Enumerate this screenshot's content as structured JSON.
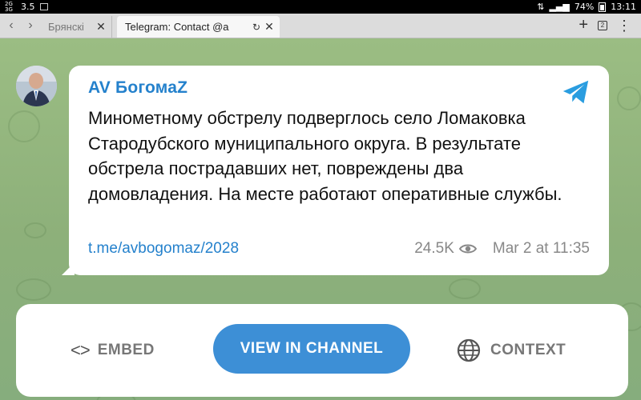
{
  "status_bar": {
    "network_label": "2G/3G",
    "speed": "3.5",
    "battery": "74%",
    "time": "13:11"
  },
  "browser": {
    "tabs": [
      {
        "label": "Брянскі",
        "active": false
      },
      {
        "label": "Telegram: Contact @a",
        "active": true
      }
    ],
    "tab_count": "2"
  },
  "post": {
    "channel_name": "AV БогомаZ",
    "text": "Минометному обстрелу подверглось село Ломаковка Стародубского муниципального округа. В результате обстрела пострадавших нет, повреждены два домовладения. На месте работают оперативные службы.",
    "link": "t.me/avbogomaz/2028",
    "views": "24.5K",
    "date": "Mar 2 at 11:35"
  },
  "actions": {
    "embed_label": "EMBED",
    "view_label": "VIEW IN CHANNEL",
    "context_label": "CONTEXT"
  },
  "colors": {
    "accent": "#2481cc",
    "button": "#3d8fd6",
    "background": "#8fb27a"
  }
}
